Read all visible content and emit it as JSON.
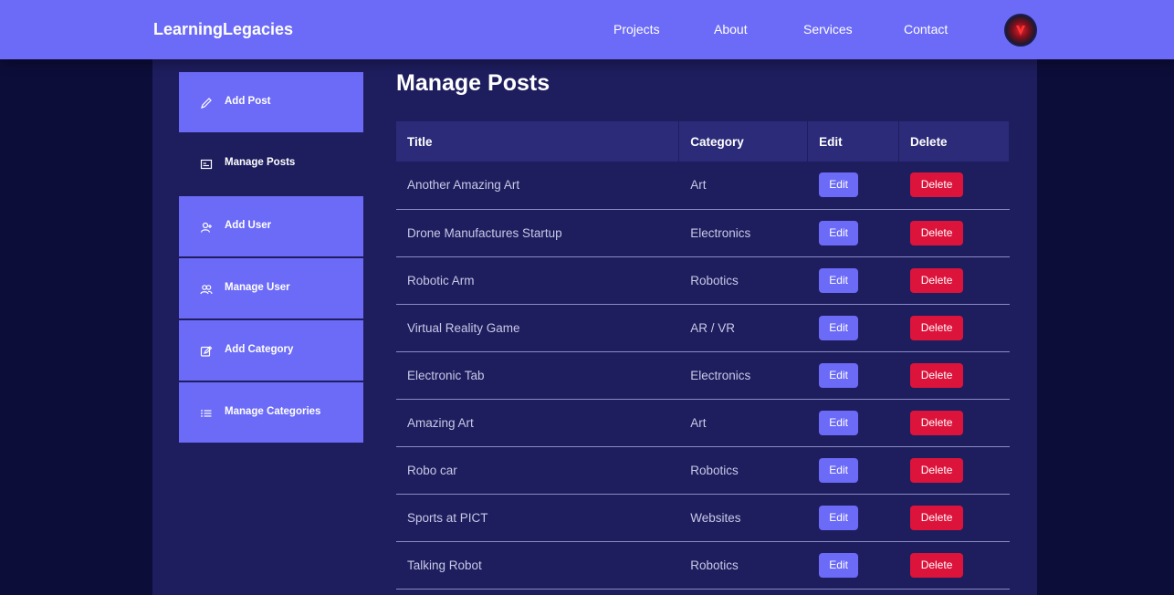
{
  "navbar": {
    "logo": "LearningLegacies",
    "links": [
      "Projects",
      "About",
      "Services",
      "Contact"
    ]
  },
  "sidebar": {
    "items": [
      {
        "label": "Add Post",
        "icon": "pencil-icon"
      },
      {
        "label": "Manage Posts",
        "icon": "posts-icon"
      },
      {
        "label": "Add User",
        "icon": "add-user-icon"
      },
      {
        "label": "Manage User",
        "icon": "users-icon"
      },
      {
        "label": "Add Category",
        "icon": "edit-box-icon"
      },
      {
        "label": "Manage Categories",
        "icon": "list-icon"
      }
    ],
    "active": "Manage Posts"
  },
  "main": {
    "title": "Manage Posts",
    "table": {
      "headers": [
        "Title",
        "Category",
        "Edit",
        "Delete"
      ],
      "rows": [
        {
          "title": "Another Amazing Art",
          "category": "Art"
        },
        {
          "title": "Drone Manufactures Startup",
          "category": "Electronics"
        },
        {
          "title": "Robotic Arm",
          "category": "Robotics"
        },
        {
          "title": "Virtual Reality Game",
          "category": "AR / VR"
        },
        {
          "title": "Electronic Tab",
          "category": "Electronics"
        },
        {
          "title": "Amazing Art",
          "category": "Art"
        },
        {
          "title": "Robo car",
          "category": "Robotics"
        },
        {
          "title": "Sports at PICT",
          "category": "Websites"
        },
        {
          "title": "Talking Robot",
          "category": "Robotics"
        }
      ],
      "edit_label": "Edit",
      "delete_label": "Delete"
    }
  },
  "colors": {
    "accent": "#6c6bf7",
    "background": "#0d0d3a",
    "panel": "#1e1d5e",
    "danger": "#dc143c"
  }
}
